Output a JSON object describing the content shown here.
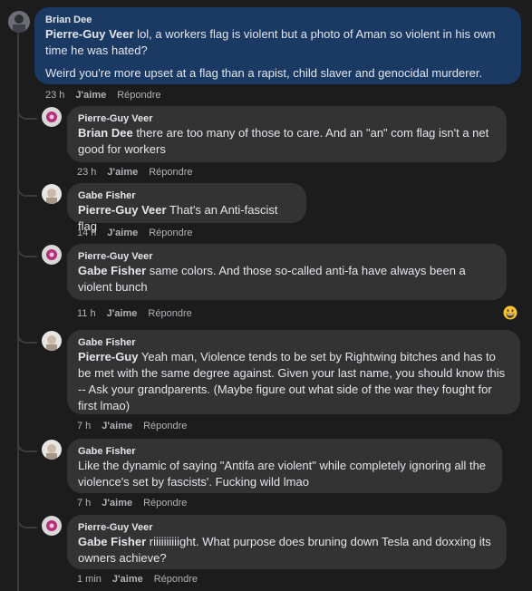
{
  "comments": [
    {
      "author": "Brian Dee",
      "mention": "Pierre-Guy Veer",
      "text": " lol, a workers flag is violent but a photo of Aman so violent in his own time he was hated?",
      "text2": "Weird you're more upset at a flag than a rapist, child slaver and genocidal murderer.",
      "time": "23 h",
      "like": "J'aime",
      "reply": "Répondre"
    },
    {
      "author": "Pierre-Guy Veer",
      "mention": "Brian Dee",
      "text": " there are too many of those to care. And an \"an\" com flag isn't a net good for workers",
      "time": "23 h",
      "like": "J'aime",
      "reply": "Répondre"
    },
    {
      "author": "Gabe Fisher",
      "mention": "Pierre-Guy Veer",
      "text": " That's an Anti-fascist flag",
      "time": "14 h",
      "like": "J'aime",
      "reply": "Répondre"
    },
    {
      "author": "Pierre-Guy Veer",
      "mention": "Gabe Fisher",
      "text": " same colors. And those so-called anti-fa have always been a violent bunch",
      "time": "11 h",
      "like": "J'aime",
      "reply": "Répondre"
    },
    {
      "author": "Gabe Fisher",
      "mention": "Pierre-Guy",
      "text": " Yeah man, Violence tends to be set by Rightwing bitches and has to be met with the same degree against. Given your last name, you should know this -- Ask your grandparents. (Maybe figure out what side of the war they fought for first lmao)",
      "time": "7 h",
      "like": "J'aime",
      "reply": "Répondre"
    },
    {
      "author": "Gabe Fisher",
      "mention": "",
      "text": "Like the dynamic of saying \"Antifa are violent\" while completely ignoring all the violence's set by fascists'. Fucking wild lmao",
      "time": "7 h",
      "like": "J'aime",
      "reply": "Répondre"
    },
    {
      "author": "Pierre-Guy Veer",
      "mention": "Gabe Fisher",
      "text": " riiiiiiiiiight. What purpose does bruning down Tesla and doxxing its owners achieve?",
      "time": "1 min",
      "like": "J'aime",
      "reply": "Répondre"
    }
  ],
  "reaction_icon": "grinning-face-emoji"
}
